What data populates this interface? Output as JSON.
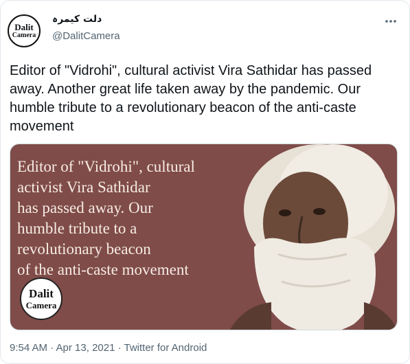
{
  "author": {
    "display_name": "دلت کیمرہ",
    "handle": "@DalitCamera",
    "avatar_text_1": "Dalit",
    "avatar_text_2": "Camera"
  },
  "tweet": {
    "text": "Editor of \"Vidrohi\", cultural activist Vira Sathidar has passed away. Another great life taken away by the pandemic. Our humble tribute to a revolutionary beacon of the anti-caste movement",
    "more_icon": "more-horizontal-icon"
  },
  "media": {
    "text": "Editor of \"Vidrohi\", cultural\nactivist Vira Sathidar\nhas passed away. Our\nhumble tribute to a\nrevolutionary beacon\nof the anti-caste movement",
    "logo_text_1": "Dalit",
    "logo_text_2": "Camera",
    "background_color": "#7f4c49"
  },
  "footer": {
    "meta": "9:54 AM · Apr 13, 2021 · Twitter for Android"
  }
}
